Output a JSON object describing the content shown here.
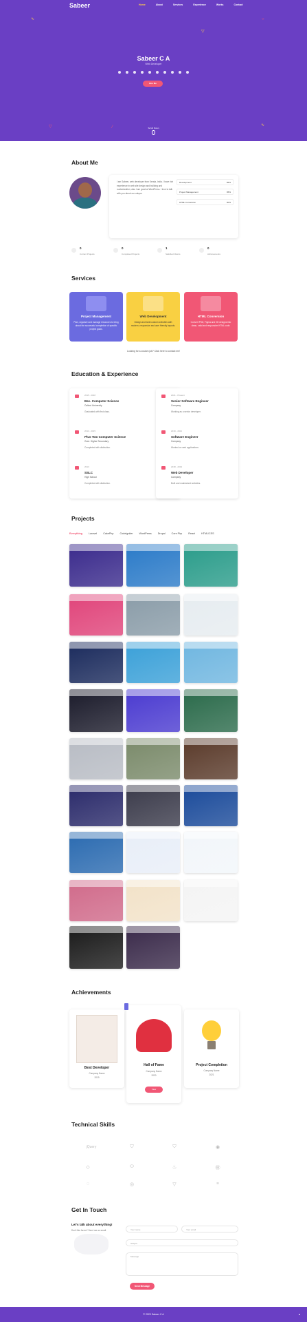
{
  "nav": {
    "logo": "Sabeer",
    "links": [
      "Home",
      "About",
      "Services",
      "Experience",
      "Works",
      "Contact"
    ],
    "active": "Home"
  },
  "hero": {
    "name": "Sabeer C A",
    "role": "Web Developer",
    "button": "Hire Me",
    "scroll_label": "Scroll Down",
    "socials": [
      "facebook-icon",
      "twitter-icon",
      "instagram-icon",
      "linkedin-icon",
      "github-icon",
      "youtube-icon",
      "medium-icon",
      "behance-icon",
      "dribbble-icon",
      "codepen-icon"
    ]
  },
  "about": {
    "title": "About Me",
    "text": "I am Sabeer, web developer from Kerala, India. I have rich experience in web site design and building and customization, also I am good at WordPress. I love to talk with you about our unique.",
    "skills": [
      {
        "label": "Development",
        "percent": 85
      },
      {
        "label": "Project Management",
        "percent": 95
      },
      {
        "label": "HTML Conversion",
        "percent": 90
      }
    ],
    "stats": [
      {
        "value": "0",
        "label": "Current Projects",
        "icon": "briefcase-icon"
      },
      {
        "value": "0",
        "label": "Completed Projects",
        "icon": "check-icon"
      },
      {
        "value": "1",
        "label": "Satisfied Clients",
        "icon": "smile-icon"
      },
      {
        "value": "0",
        "label": "Achievements",
        "icon": "trophy-icon"
      }
    ]
  },
  "services": {
    "title": "Services",
    "items": [
      {
        "title": "Project Management",
        "desc": "Plan, organize and manage resources to bring about the successful completion of specific project goals.",
        "color": "#6b6be0"
      },
      {
        "title": "Web Development",
        "desc": "Design and build custom websites with modern, responsive and user friendly layouts.",
        "color": "#f9d042"
      },
      {
        "title": "HTML Conversion",
        "desc": "Convert PSD, Figma and XD designs into clean, valid and responsive HTML code.",
        "color": "#f15775"
      }
    ],
    "note": "Looking for a custom job? Click here to contact me!"
  },
  "education": {
    "title": "Education & Experience",
    "left": [
      {
        "years": "2015 - 2018",
        "title": "Bsc. Computer Science",
        "place": "Calicut University",
        "desc": "Graduated with first class."
      },
      {
        "years": "2013 - 2015",
        "title": "Plus Two Computer Science",
        "place": "Govt. Higher Secondary",
        "desc": "Completed with distinction."
      },
      {
        "years": "2013",
        "title": "SSLC",
        "place": "High School",
        "desc": "Completed with distinction."
      }
    ],
    "right": [
      {
        "years": "2021 - Present",
        "title": "Senior Software Engineer",
        "place": "Company",
        "desc": "Working as a senior developer."
      },
      {
        "years": "2019 - 2021",
        "title": "Software Engineer",
        "place": "Company",
        "desc": "Worked on web applications."
      },
      {
        "years": "2018 - 2019",
        "title": "Web Developer",
        "place": "Company",
        "desc": "Built and maintained websites."
      }
    ]
  },
  "projects": {
    "title": "Projects",
    "filters": [
      "Everything",
      "Laravel",
      "CakePhp",
      "CodeIgniter",
      "WordPress",
      "Drupal",
      "Core Php",
      "React",
      "HTML/CSS"
    ],
    "active_filter": "Everything"
  },
  "achievements": {
    "title": "Achievements",
    "items": [
      {
        "title": "Best Developer",
        "line1": "Company Name",
        "line2": "2019"
      },
      {
        "title": "Hall of Fame",
        "line1": "Company Name",
        "line2": "2020",
        "button": "View"
      },
      {
        "title": "Project Completion",
        "line1": "Company Name",
        "line2": "2021"
      }
    ]
  },
  "skills": {
    "title": "Technical Skills"
  },
  "contact": {
    "title": "Get In Touch",
    "heading": "Let's talk about everything!",
    "subtext": "Don't like forms? Send me an email.",
    "name_placeholder": "Your name",
    "email_placeholder": "Your email",
    "subject_placeholder": "Subject",
    "message_placeholder": "Message",
    "button": "Send Message"
  },
  "footer": {
    "text": "© 2023 Sabeer C A"
  }
}
